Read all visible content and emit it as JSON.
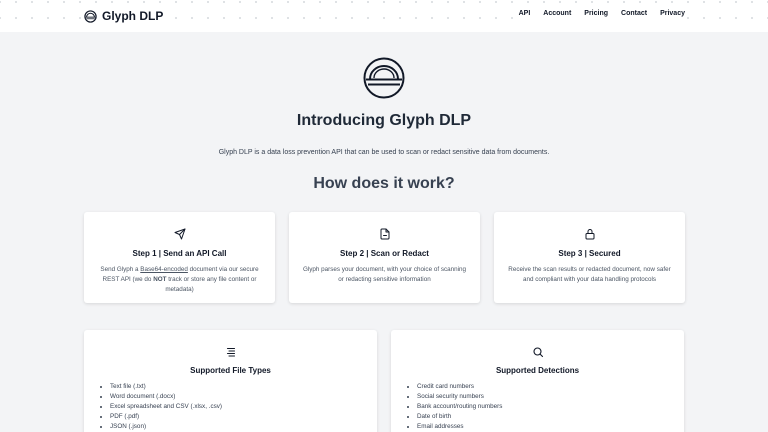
{
  "header": {
    "brand": "Glyph DLP",
    "nav": [
      "API",
      "Account",
      "Pricing",
      "Contact",
      "Privacy"
    ]
  },
  "hero": {
    "title": "Introducing Glyph DLP",
    "description": "Glyph DLP is a data loss prevention API that can be used to scan or redact sensitive data from documents.",
    "subtitle": "How does it work?"
  },
  "steps": [
    {
      "icon": "send-icon",
      "title": "Step 1 | Send an API Call",
      "body_pre": "Send Glyph a ",
      "body_link": "Base64-encoded",
      "body_mid": " document via our secure REST API (we do ",
      "body_strong": "NOT",
      "body_post": " track or store any file content or metadata)"
    },
    {
      "icon": "document-icon",
      "title": "Step 2 | Scan or Redact",
      "body": "Glyph parses your document, with your choice of scanning or redacting sensitive information"
    },
    {
      "icon": "lock-icon",
      "title": "Step 3 | Secured",
      "body": "Receive the scan results or redacted document, now safer and compliant with your data handling protocols"
    }
  ],
  "features": [
    {
      "icon": "list-icon",
      "title": "Supported File Types",
      "items": [
        "Text file (.txt)",
        "Word document (.docx)",
        "Excel spreadsheet and CSV (.xlsx, .csv)",
        "PDF (.pdf)",
        "JSON (.json)"
      ]
    },
    {
      "icon": "search-icon",
      "title": "Supported Detections",
      "items": [
        "Credit card numbers",
        "Social security numbers",
        "Bank account/routing numbers",
        "Date of birth",
        "Email addresses"
      ]
    }
  ]
}
